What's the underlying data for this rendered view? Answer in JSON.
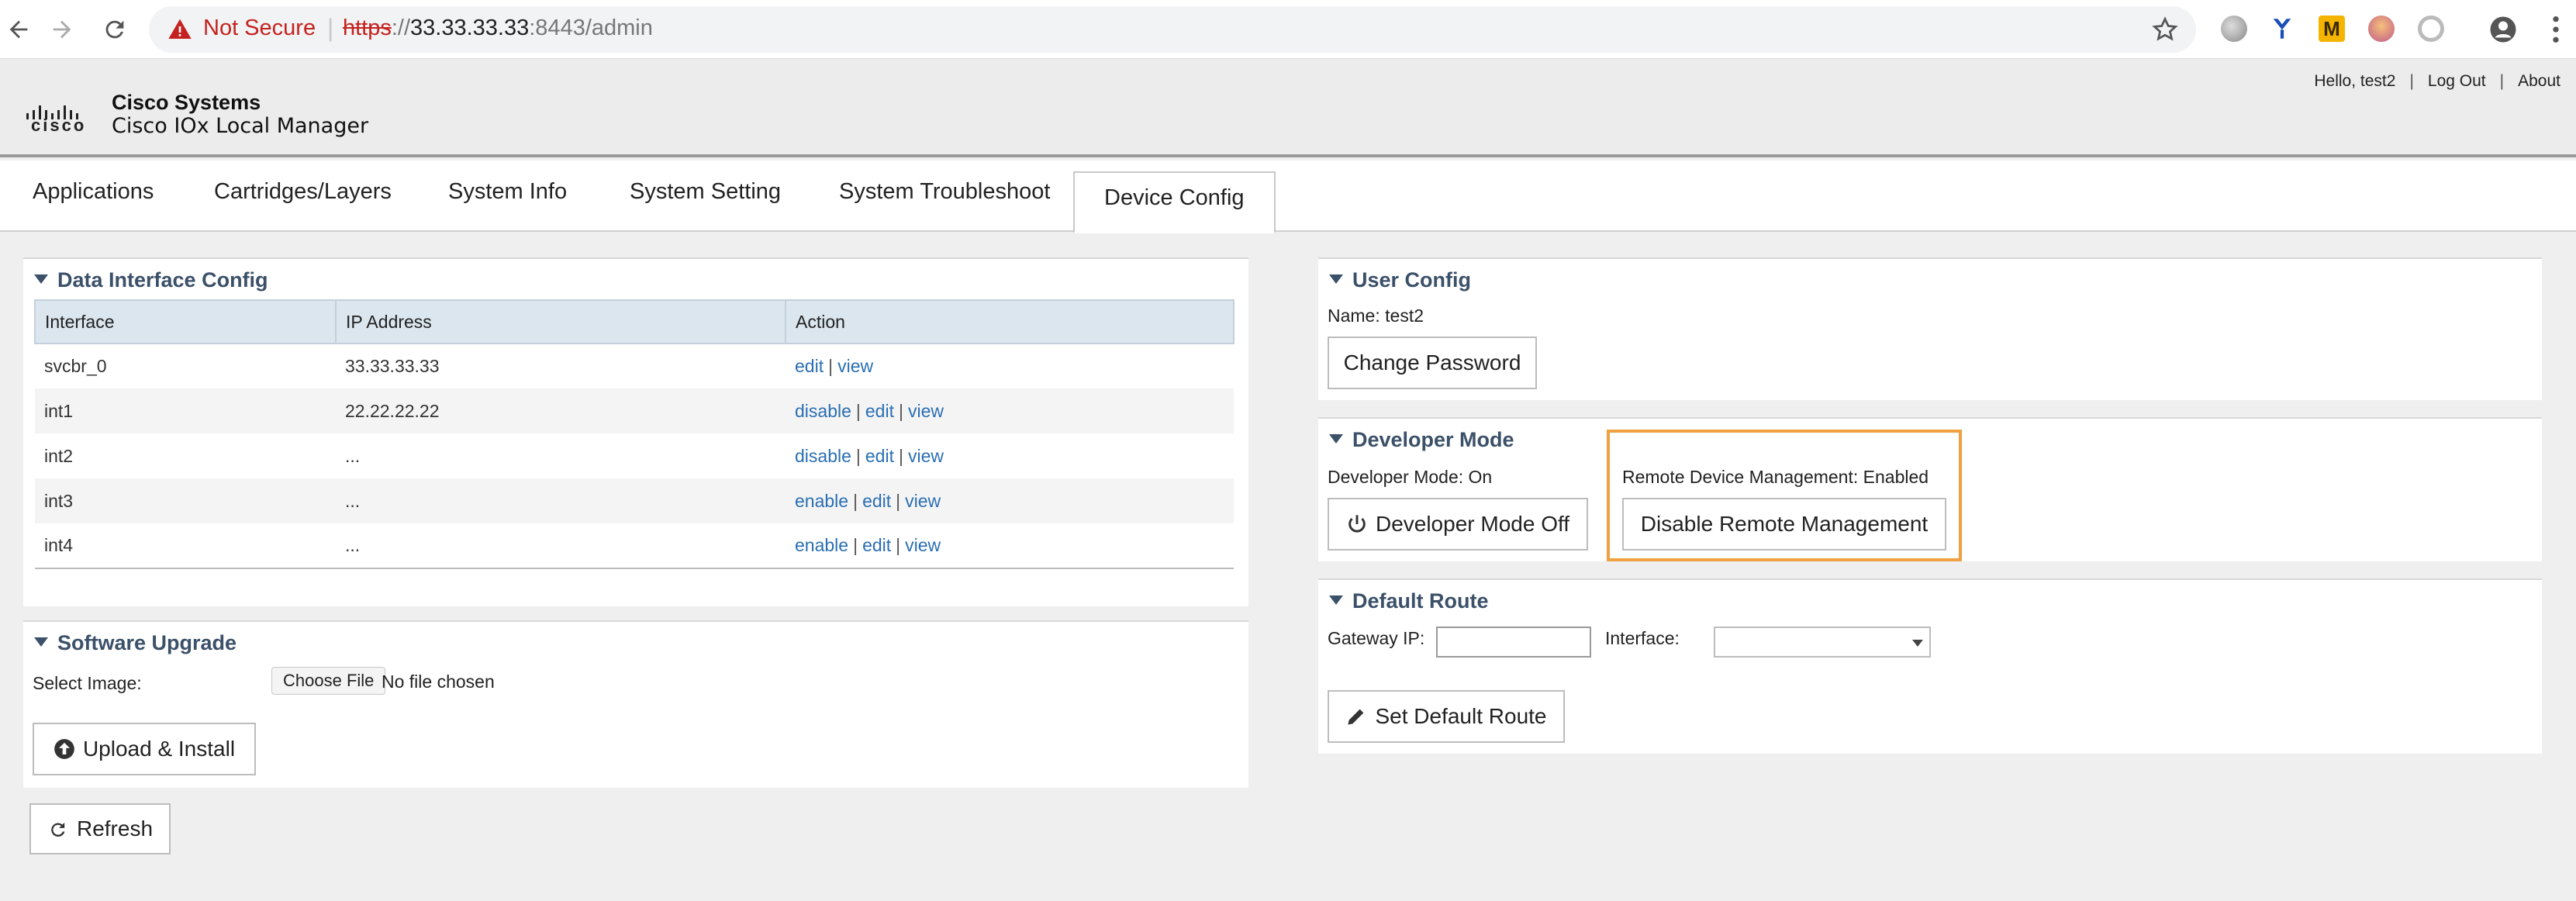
{
  "browser": {
    "security_label": "Not Secure",
    "separator": "|",
    "url_scheme": "https",
    "url_sep": "://",
    "url_host": "33.33.33.33",
    "url_rest": ":8443/admin",
    "extension_m": "M"
  },
  "header": {
    "logo_word": "cisco",
    "brand_title": "Cisco Systems",
    "brand_subtitle": "Cisco IOx Local Manager",
    "greeting": "Hello, test2",
    "logout": "Log Out",
    "about": "About",
    "link_separator": "|"
  },
  "tabs": [
    {
      "label": "Applications"
    },
    {
      "label": "Cartridges/Layers"
    },
    {
      "label": "System Info"
    },
    {
      "label": "System Setting"
    },
    {
      "label": "System Troubleshoot"
    },
    {
      "label": "Device Config"
    }
  ],
  "active_tab": "Device Config",
  "data_interface": {
    "title": "Data Interface Config",
    "columns": [
      "Interface",
      "IP Address",
      "Action"
    ],
    "rows": [
      {
        "interface": "svcbr_0",
        "ip": "33.33.33.33",
        "actions": [
          "edit",
          "view"
        ]
      },
      {
        "interface": "int1",
        "ip": "22.22.22.22",
        "actions": [
          "disable",
          "edit",
          "view"
        ]
      },
      {
        "interface": "int2",
        "ip": "...",
        "actions": [
          "disable",
          "edit",
          "view"
        ]
      },
      {
        "interface": "int3",
        "ip": "...",
        "actions": [
          "enable",
          "edit",
          "view"
        ]
      },
      {
        "interface": "int4",
        "ip": "...",
        "actions": [
          "enable",
          "edit",
          "view"
        ]
      }
    ],
    "action_separator": "|"
  },
  "software_upgrade": {
    "title": "Software Upgrade",
    "select_label": "Select Image:",
    "choose_file": "Choose File",
    "no_file": "No file chosen",
    "upload_button": "Upload & Install"
  },
  "refresh_button": "Refresh",
  "user_config": {
    "title": "User Config",
    "name_line": "Name: test2",
    "change_password": "Change Password"
  },
  "developer_mode": {
    "title": "Developer Mode",
    "status": "Developer Mode: On",
    "toggle_button": "Developer Mode Off",
    "remote_status": "Remote Device Management: Enabled",
    "remote_button": "Disable Remote Management",
    "highlight_color": "#f0a040"
  },
  "default_route": {
    "title": "Default Route",
    "gateway_label": "Gateway IP:",
    "gateway_value": "",
    "interface_label": "Interface:",
    "interface_value": "",
    "set_button": "Set Default Route"
  }
}
